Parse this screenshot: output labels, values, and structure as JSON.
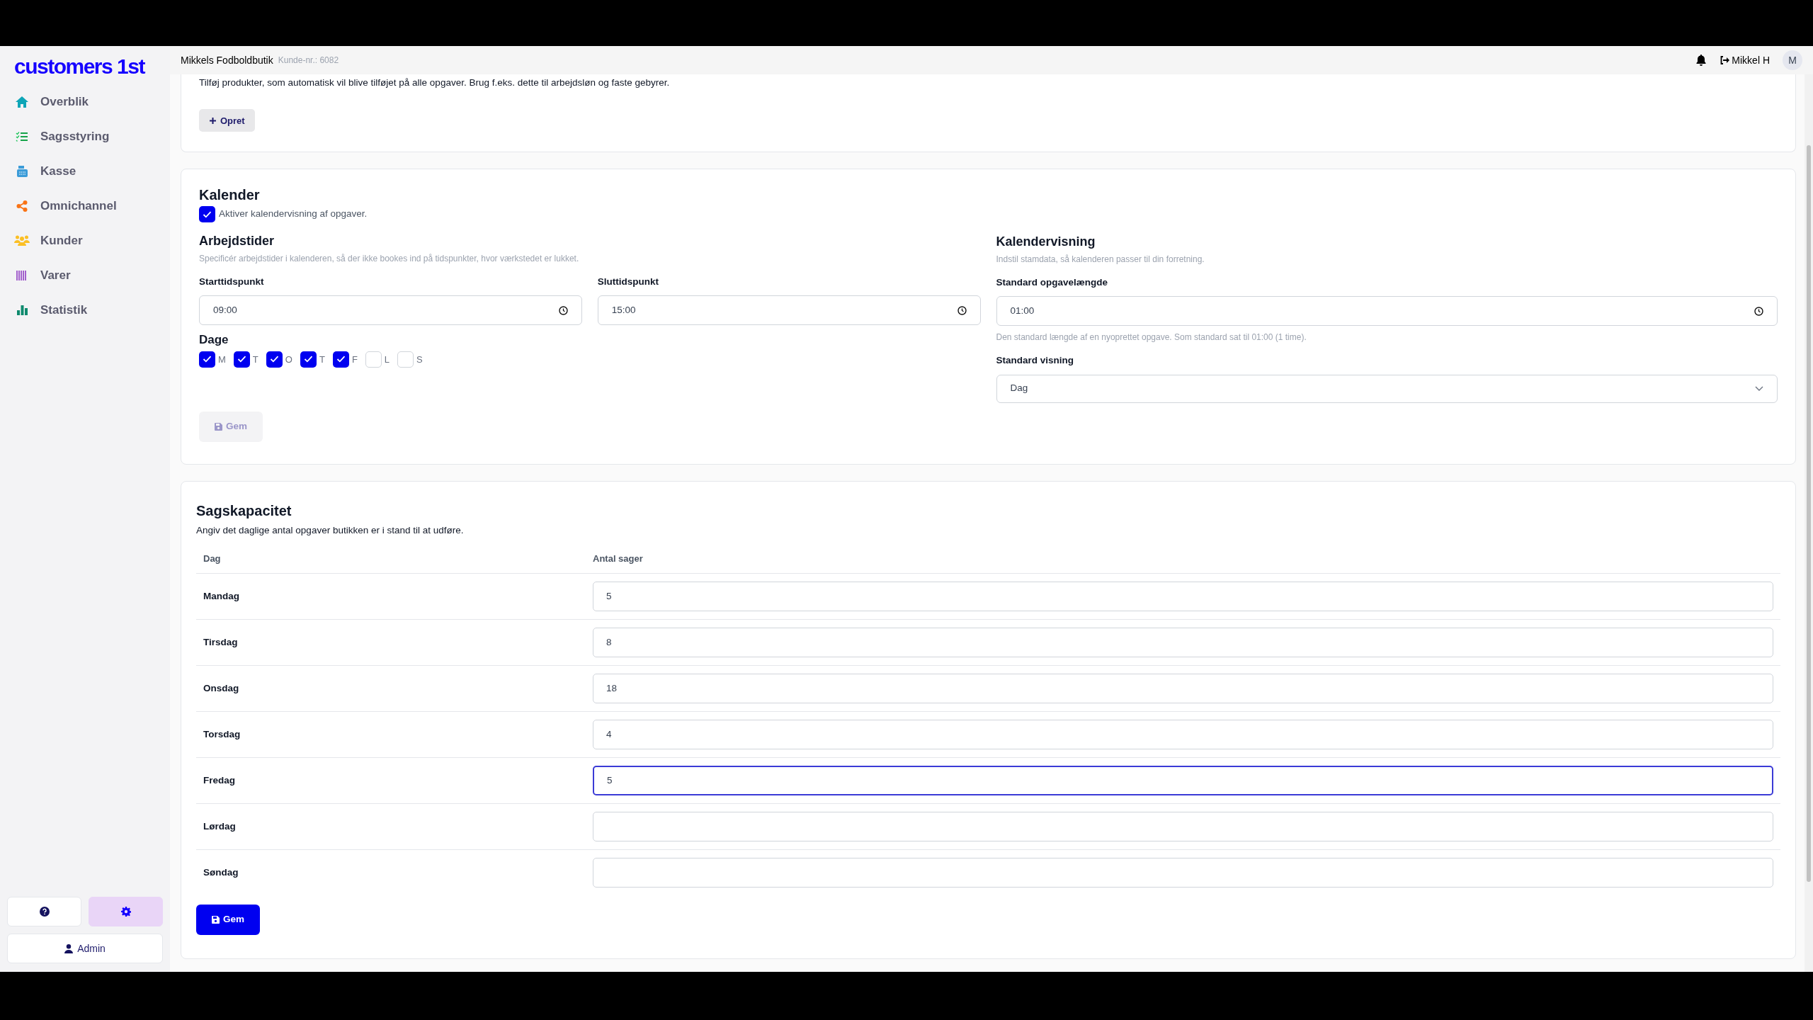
{
  "brand": "customers 1st",
  "nav": [
    {
      "label": "Overblik"
    },
    {
      "label": "Sagsstyring"
    },
    {
      "label": "Kasse"
    },
    {
      "label": "Omnichannel"
    },
    {
      "label": "Kunder"
    },
    {
      "label": "Varer"
    },
    {
      "label": "Statistik"
    }
  ],
  "sidebar_footer": {
    "buttons": [
      {
        "kind": "help",
        "selected": false
      },
      {
        "kind": "settings",
        "selected": true
      }
    ],
    "admin": "Admin"
  },
  "header": {
    "shop": "Mikkels Fodboldbutik",
    "customer_no": "Kunde-nr.: 6082",
    "user": "Mikkel H",
    "avatar": "M"
  },
  "products_card": {
    "description": "Tilføj produkter, som automatisk vil blive tilføjet på alle opgaver. Brug f.eks. dette til arbejdsløn og faste gebyrer.",
    "button": "Opret"
  },
  "calendar": {
    "title": "Kalender",
    "enable": {
      "label": "Aktiver kalendervisning af opgaver.",
      "checked": true
    },
    "work_hours": {
      "title": "Arbejdstider",
      "description": "Specificér arbejdstider i kalenderen, så der ikke bookes ind på tidspunkter, hvor værkstedet er lukket.",
      "start": {
        "label": "Starttidspunkt",
        "value": "09:00"
      },
      "end": {
        "label": "Sluttidspunkt",
        "value": "15:00"
      },
      "days_title": "Dage",
      "days": [
        {
          "label": "M",
          "checked": true
        },
        {
          "label": "T",
          "checked": true
        },
        {
          "label": "O",
          "checked": true
        },
        {
          "label": "T",
          "checked": true
        },
        {
          "label": "F",
          "checked": true
        },
        {
          "label": "L",
          "checked": false
        },
        {
          "label": "S",
          "checked": false
        }
      ],
      "save": {
        "label": "Gem",
        "disabled": true
      }
    },
    "view": {
      "title": "Kalendervisning",
      "description": "Indstil stamdata, så kalenderen passer til din forretning.",
      "length": {
        "label": "Standard opgavelængde",
        "value": "01:00",
        "help": "Den standard længde af en nyoprettet opgave. Som standard sat til 01:00 (1 time)."
      },
      "mode": {
        "label": "Standard visning",
        "value": "Dag"
      }
    }
  },
  "capacity": {
    "title": "Sagskapacitet",
    "description": "Angiv det daglige antal opgaver butikken er i stand til at udføre.",
    "columns": [
      "Dag",
      "Antal sager"
    ],
    "rows": [
      {
        "day": "Mandag",
        "value": "5",
        "focused": false
      },
      {
        "day": "Tirsdag",
        "value": "8",
        "focused": false
      },
      {
        "day": "Onsdag",
        "value": "18",
        "focused": false
      },
      {
        "day": "Torsdag",
        "value": "4",
        "focused": false
      },
      {
        "day": "Fredag",
        "value": "5",
        "focused": true
      },
      {
        "day": "Lørdag",
        "focused": false
      },
      {
        "day": "Søndag",
        "focused": false
      }
    ],
    "save": {
      "label": "Gem",
      "disabled": false
    }
  }
}
